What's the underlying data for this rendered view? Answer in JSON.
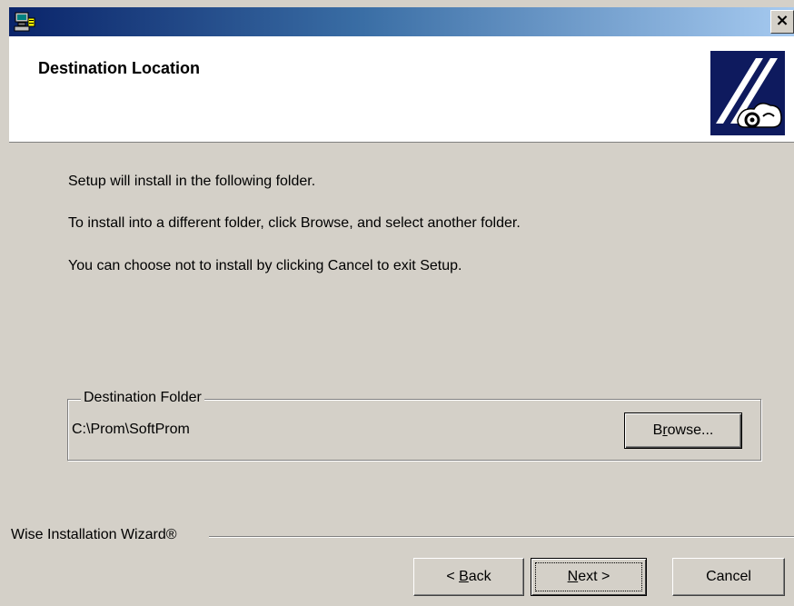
{
  "window": {
    "close_glyph": "×",
    "title_icon": "setup-computer-icon"
  },
  "header": {
    "title": "Destination Location",
    "logo": "installer-logo-icon"
  },
  "messages": {
    "line1": "Setup will install  in the following folder.",
    "line2": "To install into a different folder, click Browse, and select another folder.",
    "line3": "You can choose not to install  by clicking Cancel to exit Setup."
  },
  "destination": {
    "group_label": "Destination Folder",
    "path": "C:\\Prom\\SoftProm",
    "browse": {
      "prefix": "B",
      "mnemonic": "r",
      "suffix": "owse..."
    }
  },
  "footer": {
    "brand": "Wise Installation Wizard®",
    "back": {
      "prefix": "< ",
      "mnemonic": "B",
      "suffix": "ack"
    },
    "next": {
      "mnemonic": "N",
      "suffix": "ext >"
    },
    "cancel": "Cancel"
  },
  "colors": {
    "face": "#d4d0c8",
    "title_start": "#0a246a",
    "title_end": "#a6caf0",
    "logo_bg": "#0e1a5e"
  }
}
